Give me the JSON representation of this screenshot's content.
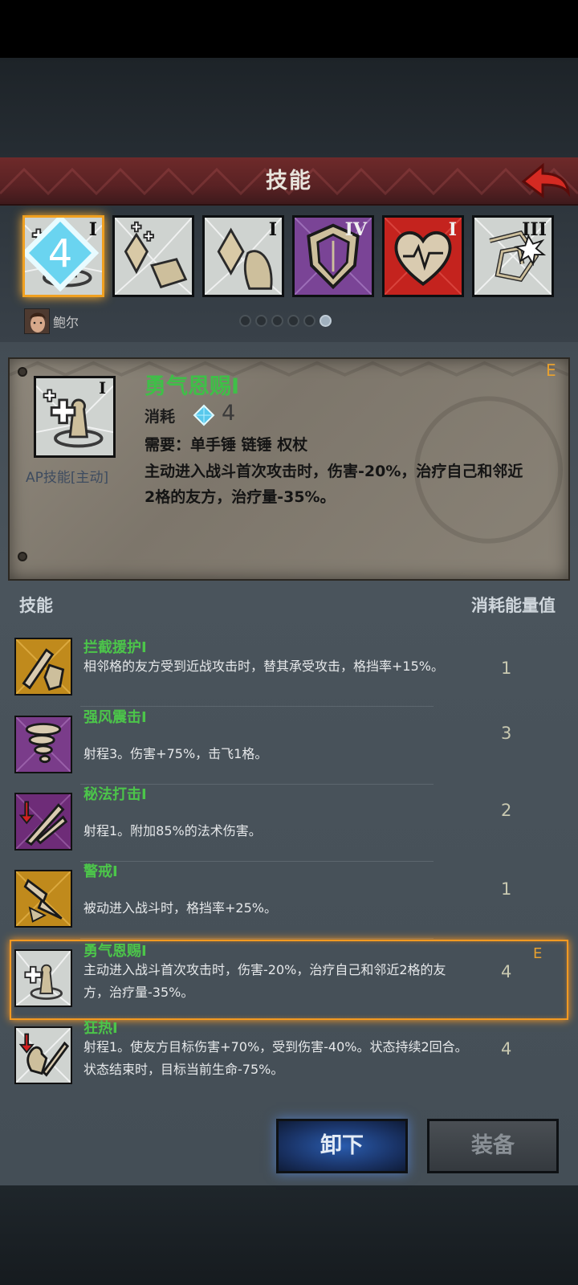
{
  "header": {
    "title": "技能"
  },
  "skill_slots": [
    {
      "rank": "I",
      "name": "勇气恩赐",
      "selected": true,
      "badge": "4"
    },
    {
      "rank": "",
      "name": "crystal-skill"
    },
    {
      "rank": "I",
      "name": "crystal-pray"
    },
    {
      "rank": "IV",
      "name": "shield"
    },
    {
      "rank": "I",
      "name": "heart"
    },
    {
      "rank": "III",
      "name": "spiral-burst"
    }
  ],
  "hero": {
    "name": "鲍尔"
  },
  "pager": {
    "total": 6,
    "active": 6
  },
  "detail": {
    "name": "勇气恩赐I",
    "equipped_mark": "E",
    "type": "AP技能[主动]",
    "cost_label": "消耗",
    "cost_value": "4",
    "requirement": "需要：单手锤  链锤  权杖",
    "description": "主动进入战斗首次攻击时，伤害-20%，治疗自己和邻近2格的友方，治疗量-35%。"
  },
  "list": {
    "col_skill": "技能",
    "col_cost": "消耗能量值",
    "items": [
      {
        "name": "拦截援护I",
        "desc": "相邻格的友方受到近战攻击时，替其承受攻击，格挡率+15%。",
        "cost": "1",
        "icon": "intercept-icon",
        "color": "#c08a1c"
      },
      {
        "name": "强风震击I",
        "desc": "射程3。伤害+75%，击飞1格。",
        "cost": "3",
        "icon": "tornado-icon",
        "color": "#7a3c8a"
      },
      {
        "name": "秘法打击I",
        "desc": "射程1。附加85%的法术伤害。",
        "cost": "2",
        "icon": "arcane-strike-icon",
        "color": "#6e2c78"
      },
      {
        "name": "警戒I",
        "desc": "被动进入战斗时，格挡率+25%。",
        "cost": "1",
        "icon": "vigilance-icon",
        "color": "#c08a1c"
      },
      {
        "name": "勇气恩赐I",
        "desc": "主动进入战斗首次攻击时，伤害-20%，治疗自己和邻近2格的友方，治疗量-35%。",
        "cost": "4",
        "icon": "courage-grace-icon",
        "color": "#c9ccc8",
        "equipped_mark": "E"
      },
      {
        "name": "狂热I",
        "desc": "射程1。使友方目标伤害+70%，受到伤害-40%。状态持续2回合。状态结束时，目标当前生命-75%。",
        "cost": "4",
        "icon": "frenzy-icon",
        "color": "#c9ccc8"
      }
    ]
  },
  "buttons": {
    "unequip": "卸下",
    "equip": "装备"
  }
}
